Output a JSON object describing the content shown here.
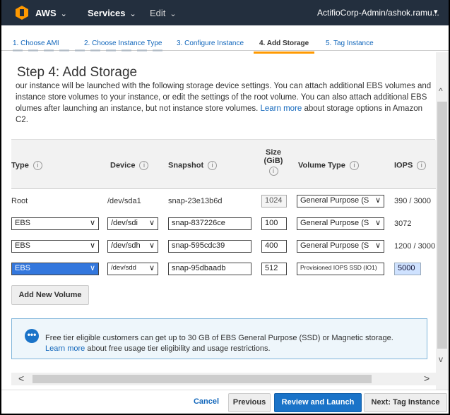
{
  "nav": {
    "brand": "AWS",
    "services": "Services",
    "edit": "Edit",
    "account": "ActifioCorp-Admin/ashok.ramu...",
    "chevron": "⌄",
    "logo_color": "#f90"
  },
  "tabs": [
    {
      "label": "1. Choose AMI"
    },
    {
      "label": "2. Choose Instance Type"
    },
    {
      "label": "3. Configure Instance"
    },
    {
      "label": "4. Add Storage"
    },
    {
      "label": "5. Tag Instance"
    }
  ],
  "page": {
    "title": "Step 4: Add Storage",
    "desc_part1": "our instance will be launched with the following storage device settings. You can attach additional EBS volumes and instance store volumes to your instance, or edit the settings of the root volume. You can also attach additional EBS olumes after launching an instance, but not instance store volumes. ",
    "learn_more": "Learn more",
    "desc_part2": " about storage options in Amazon C2."
  },
  "table": {
    "headers": {
      "type": "Type",
      "device": "Device",
      "snapshot": "Snapshot",
      "size_line1": "Size",
      "size_line2": "(GiB)",
      "volume_type": "Volume Type",
      "iops": "IOPS",
      "info_glyph": "i"
    },
    "rows": [
      {
        "type": "Root",
        "device": "/dev/sda1",
        "snapshot": "snap-23e13b6d",
        "size": "1024",
        "volume_type": "General Purpose (S",
        "iops": "390 / 3000"
      },
      {
        "type": "EBS",
        "device": "/dev/sdi",
        "snapshot": "snap-837226ce",
        "size": "100",
        "volume_type": "General Purpose (S",
        "iops": "3072"
      },
      {
        "type": "EBS",
        "device": "/dev/sdh",
        "snapshot": "snap-595cdc39",
        "size": "400",
        "volume_type": "General Purpose (S",
        "iops": "1200 / 3000"
      },
      {
        "type": "EBS",
        "device": "/dev/sdd",
        "snapshot": "snap-95dbaadb",
        "size": "512",
        "volume_type": "Provisioned IOPS SSD (IO1)",
        "iops": "5000"
      }
    ]
  },
  "add_volume": "Add New Volume",
  "notice": {
    "badge": "•••",
    "text1": "Free tier eligible customers can get up to 30 GB of EBS General Purpose (SSD) or Magnetic storage.",
    "link": "Learn more",
    "text2": " about free usage tier eligibility and usage restrictions."
  },
  "scroll": {
    "up": "^",
    "down": "v",
    "left": "<",
    "right": ">"
  },
  "footer": {
    "cancel": "Cancel",
    "previous": "Previous",
    "review": "Review and Launch",
    "next": "Next: Tag Instance"
  }
}
